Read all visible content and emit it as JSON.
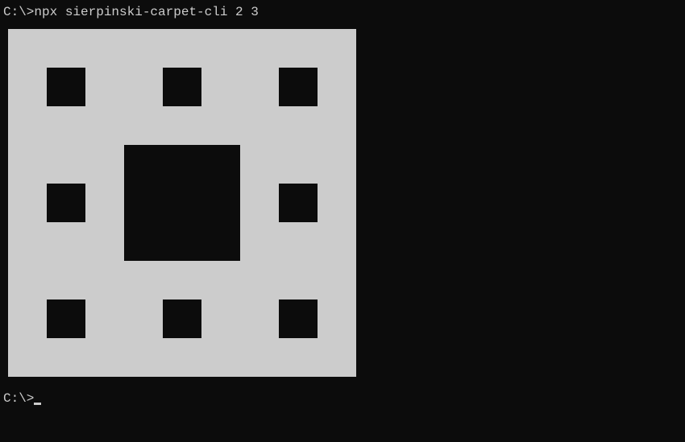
{
  "terminal": {
    "prompt1_prefix": "C:\\>",
    "command": "npx sierpinski-carpet-cli 2 3",
    "prompt2_prefix": "C:\\>"
  },
  "carpet": {
    "iterations": 2,
    "scale": 3,
    "grid_size": 9,
    "pattern": [
      [
        1,
        1,
        1,
        1,
        1,
        1,
        1,
        1,
        1
      ],
      [
        1,
        0,
        1,
        1,
        0,
        1,
        1,
        0,
        1
      ],
      [
        1,
        1,
        1,
        1,
        1,
        1,
        1,
        1,
        1
      ],
      [
        1,
        1,
        1,
        0,
        0,
        0,
        1,
        1,
        1
      ],
      [
        1,
        0,
        1,
        0,
        0,
        0,
        1,
        0,
        1
      ],
      [
        1,
        1,
        1,
        0,
        0,
        0,
        1,
        1,
        1
      ],
      [
        1,
        1,
        1,
        1,
        1,
        1,
        1,
        1,
        1
      ],
      [
        1,
        0,
        1,
        1,
        0,
        1,
        1,
        0,
        1
      ],
      [
        1,
        1,
        1,
        1,
        1,
        1,
        1,
        1,
        1
      ]
    ],
    "fg_color": "#cccccc",
    "bg_color": "#0c0c0c"
  }
}
